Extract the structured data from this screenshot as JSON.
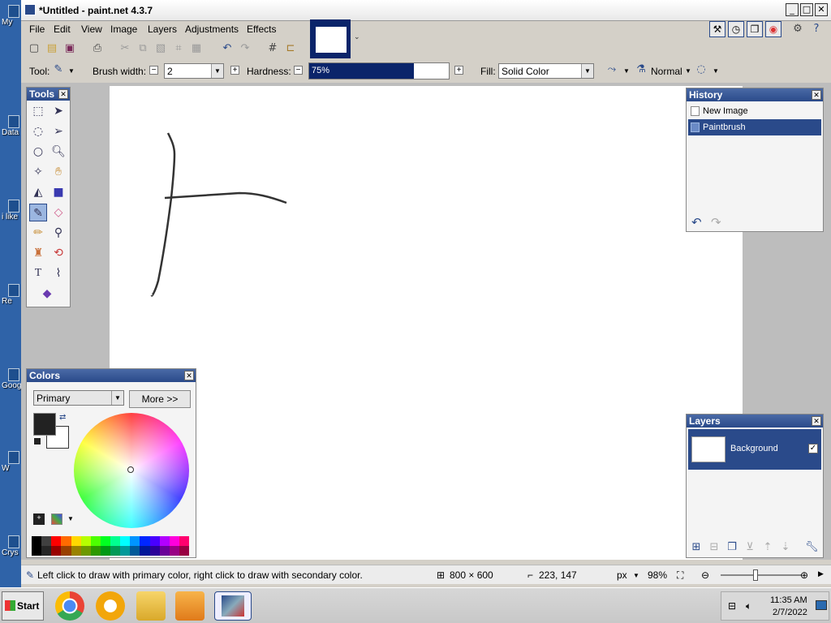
{
  "desktop": {
    "icons": [
      {
        "label": "My"
      },
      {
        "label": "Data"
      },
      {
        "label": "i like"
      },
      {
        "label": "Re"
      },
      {
        "label": "Goog"
      },
      {
        "label": "W"
      },
      {
        "label": "Crys"
      }
    ]
  },
  "window": {
    "title": "*Untitled - paint.net 4.3.7",
    "controls": {
      "minimize": "_",
      "maximize": "□",
      "close": "✕"
    }
  },
  "menu": [
    "File",
    "Edit",
    "View",
    "Image",
    "Layers",
    "Adjustments",
    "Effects"
  ],
  "toolbar": {
    "tool_label": "Tool:",
    "brush_width_label": "Brush width:",
    "brush_width_value": "2",
    "hardness_label": "Hardness:",
    "hardness_value": "75%",
    "hardness_fraction": 0.75,
    "fill_label": "Fill:",
    "fill_value": "Solid Color",
    "blend_mode": "Normal"
  },
  "tools_panel": {
    "title": "Tools"
  },
  "history_panel": {
    "title": "History",
    "items": [
      {
        "label": "New Image",
        "selected": false
      },
      {
        "label": "Paintbrush",
        "selected": true
      }
    ]
  },
  "colors_panel": {
    "title": "Colors",
    "mode": "Primary",
    "more_button": "More >>",
    "primary_color": "#222222",
    "secondary_color": "#ffffff",
    "palette": [
      "#000000",
      "#404040",
      "#ff0000",
      "#ff6a00",
      "#ffd800",
      "#b6ff00",
      "#4cff00",
      "#00ff21",
      "#00ff90",
      "#00ffff",
      "#0094ff",
      "#0026ff",
      "#4800ff",
      "#b200ff",
      "#ff00dc",
      "#ff006e"
    ]
  },
  "layers_panel": {
    "title": "Layers",
    "items": [
      {
        "label": "Background",
        "visible": true
      }
    ]
  },
  "statusbar": {
    "hint": "Left click to draw with primary color, right click to draw with secondary color.",
    "image_size": "800 × 600",
    "cursor_pos": "223, 147",
    "units": "px",
    "zoom": "98%"
  },
  "taskbar": {
    "start_label": "Start",
    "clock_time": "11:35 AM",
    "clock_date": "2/7/2022"
  },
  "colors": {
    "accent": "#2a4a8a",
    "canvas_bg": "#ffffff",
    "workspace": "#bdbdbd"
  }
}
